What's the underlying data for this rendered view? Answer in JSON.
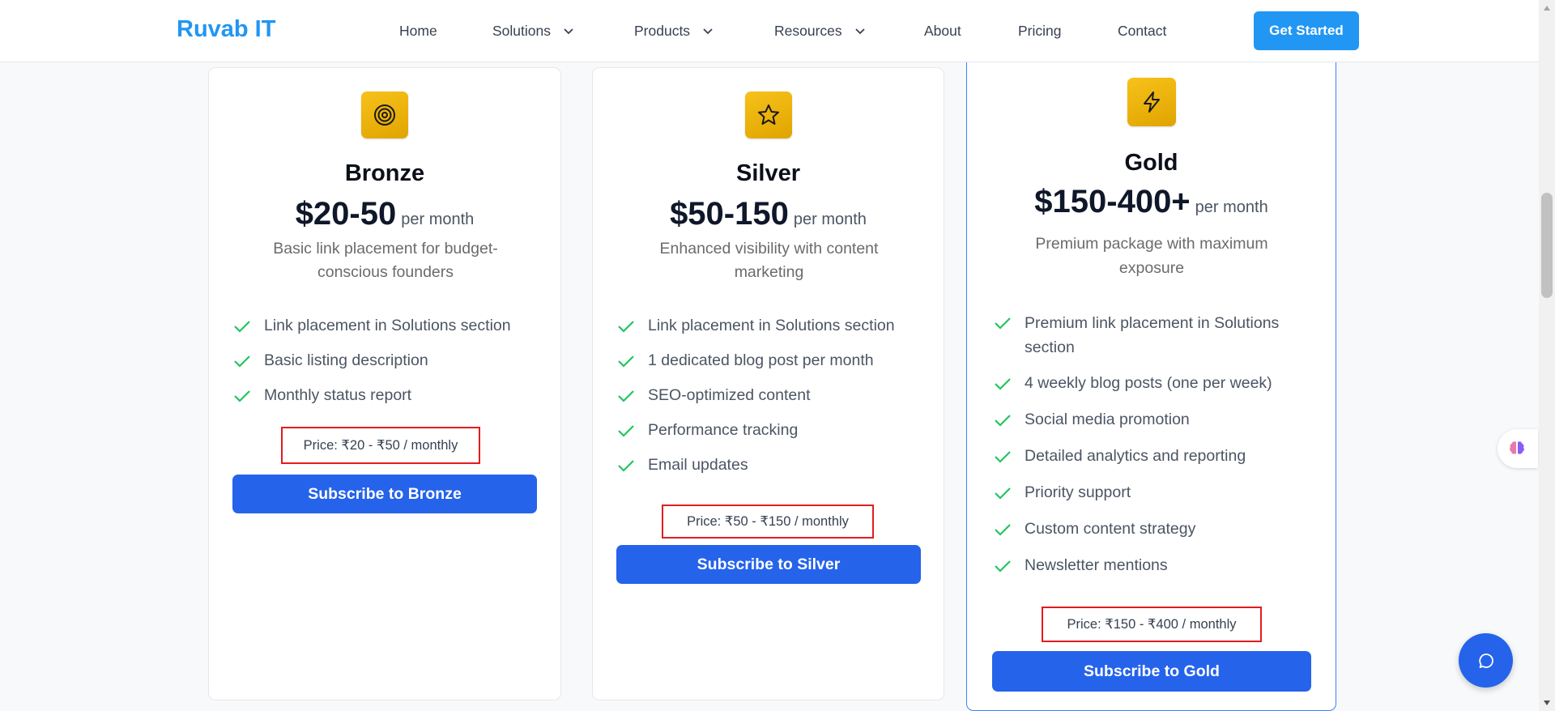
{
  "header": {
    "logo": "Ruvab IT",
    "nav": [
      {
        "label": "Home",
        "dropdown": false
      },
      {
        "label": "Solutions",
        "dropdown": true
      },
      {
        "label": "Products",
        "dropdown": true
      },
      {
        "label": "Resources",
        "dropdown": true
      },
      {
        "label": "About",
        "dropdown": false
      },
      {
        "label": "Pricing",
        "dropdown": false
      },
      {
        "label": "Contact",
        "dropdown": false
      }
    ],
    "cta": "Get Started"
  },
  "plans": [
    {
      "icon": "target-icon",
      "name": "Bronze",
      "price": "$20-50",
      "unit": "per month",
      "description": "Basic link placement for budget-conscious founders",
      "features": [
        "Link placement in Solutions section",
        "Basic listing description",
        "Monthly status report"
      ],
      "price_note": "Price: ₹20 - ₹50 / monthly",
      "button": "Subscribe to Bronze"
    },
    {
      "icon": "star-icon",
      "name": "Silver",
      "price": "$50-150",
      "unit": "per month",
      "description": "Enhanced visibility with content marketing",
      "features": [
        "Link placement in Solutions section",
        "1 dedicated blog post per month",
        "SEO-optimized content",
        "Performance tracking",
        "Email updates"
      ],
      "price_note": "Price: ₹50 - ₹150 / monthly",
      "button": "Subscribe to Silver"
    },
    {
      "icon": "lightning-icon",
      "name": "Gold",
      "price": "$150-400+",
      "unit": "per month",
      "description": "Premium package with maximum exposure",
      "features": [
        "Premium link placement in Solutions section",
        "4 weekly blog posts (one per week)",
        "Social media promotion",
        "Detailed analytics and reporting",
        "Priority support",
        "Custom content strategy",
        "Newsletter mentions"
      ],
      "price_note": "Price: ₹150 - ₹400 / monthly",
      "button": "Subscribe to Gold"
    }
  ],
  "colors": {
    "brand": "#2196f3",
    "button": "#2563eb",
    "check": "#22c55e",
    "highlight_border": "#e11d1d",
    "icon_gold": "#f0b90b"
  }
}
